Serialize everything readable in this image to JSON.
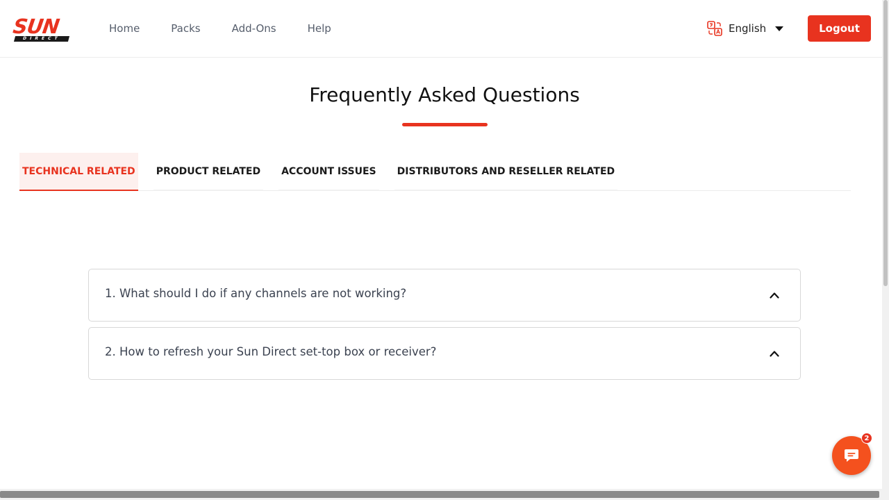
{
  "brand": {
    "logo_main": "SUN",
    "logo_sub": "DIRECT",
    "accent": "#e8331f"
  },
  "nav": {
    "items": [
      "Home",
      "Packs",
      "Add-Ons",
      "Help"
    ]
  },
  "language": {
    "label": "English",
    "icon": "translate-icon"
  },
  "header": {
    "logout_label": "Logout"
  },
  "page": {
    "title": "Frequently Asked Questions"
  },
  "tabs": [
    {
      "label": "TECHNICAL RELATED",
      "active": true
    },
    {
      "label": "PRODUCT RELATED",
      "active": false
    },
    {
      "label": "ACCOUNT ISSUES",
      "active": false
    },
    {
      "label": "DISTRIBUTORS AND RESELLER RELATED",
      "active": false
    }
  ],
  "faq": [
    {
      "question": "1. What should I do if any channels are not working?",
      "icon": "chevron-up-icon"
    },
    {
      "question": "2. How to refresh your Sun Direct set-top box or receiver?",
      "icon": "chevron-up-icon"
    }
  ],
  "chat": {
    "badge_count": "2",
    "icon": "chat-icon",
    "color": "#f4511e"
  }
}
